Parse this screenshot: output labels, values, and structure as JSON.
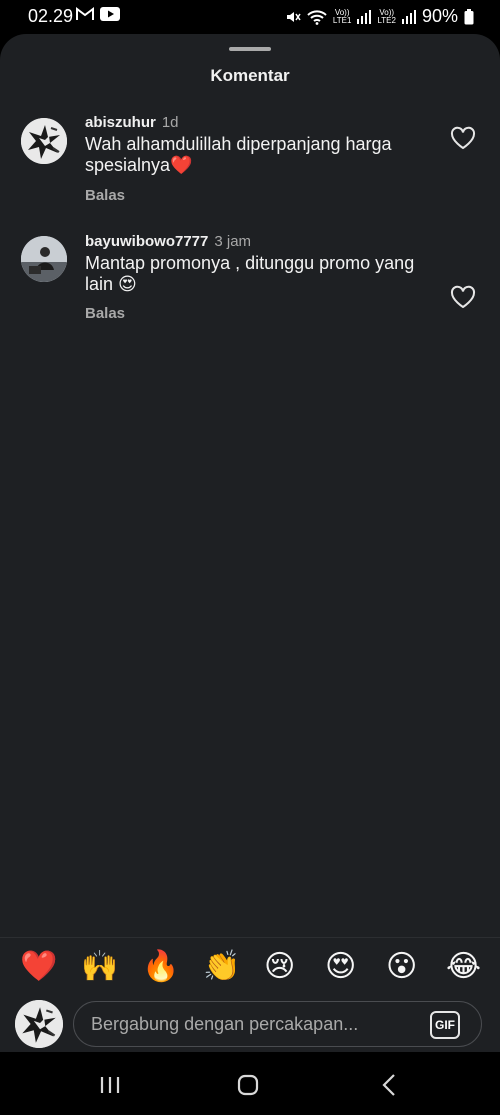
{
  "status": {
    "time": "02.29",
    "battery": "90%",
    "lte1": "LTE1",
    "lte2": "LTE2",
    "volte": "Vo))"
  },
  "sheet": {
    "title": "Komentar"
  },
  "comments": [
    {
      "username": "abiszuhur",
      "time": "1d",
      "text": "Wah alhamdulillah diperpanjang harga spesialnya",
      "emoji": "❤️",
      "reply_label": "Balas"
    },
    {
      "username": "bayuwibowo7777",
      "time": "3 jam",
      "text": "Mantap promonya , ditunggu promo yang lain",
      "emoji": "😍",
      "reply_label": "Balas"
    }
  ],
  "reactions": [
    "❤️",
    "🙌",
    "🔥",
    "👏",
    "😢",
    "😍",
    "😮",
    "😂"
  ],
  "input": {
    "placeholder": "Bergabung dengan percakapan...",
    "gif_label": "GIF"
  },
  "colors": {
    "sheet_background": "#1e2023",
    "secondary_text": "#a8a8a8"
  }
}
